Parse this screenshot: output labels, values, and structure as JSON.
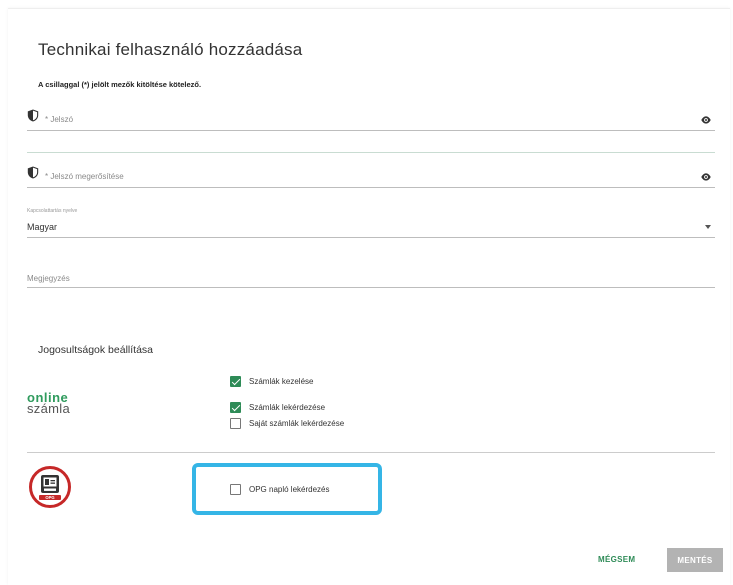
{
  "dialog": {
    "title": "Technikai felhasználó hozzáadása",
    "required_note": "A csillaggal (*) jelölt mezők kitöltése kötelező."
  },
  "fields": {
    "password": {
      "label": "* Jelszó"
    },
    "password_confirm": {
      "label": "* Jelszó megerősítése"
    },
    "language": {
      "label": "Kapcsolattartás nyelve",
      "value": "Magyar"
    },
    "note": {
      "label": "Megjegyzés"
    }
  },
  "permissions": {
    "title": "Jogosultságok beállítása",
    "online_logo": {
      "line1": "online",
      "line2": "számla"
    },
    "items": [
      {
        "label": "Számlák kezelése",
        "checked": true
      },
      {
        "label": "Számlák lekérdezése",
        "checked": true
      },
      {
        "label": "Saját számlák lekérdezése",
        "checked": false
      }
    ],
    "opg": {
      "badge": "OPG",
      "label": "OPG napló lekérdezés",
      "checked": false
    }
  },
  "actions": {
    "cancel_label": "MÉGSEM",
    "save_label": "MENTÉS"
  },
  "colors": {
    "accent": "#2e8b57",
    "highlight": "#35b5e6",
    "save_disabled": "#b3b3b3",
    "opg_red": "#c62828"
  },
  "icons": {
    "field_icon": "shield-icon",
    "visibility": "eye-icon",
    "dropdown": "chevron-down-icon"
  }
}
